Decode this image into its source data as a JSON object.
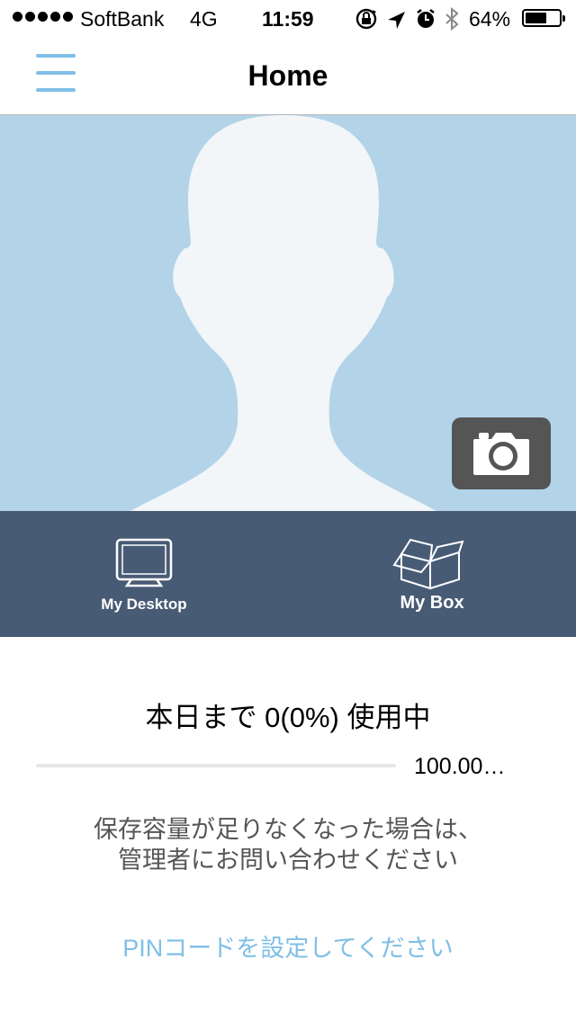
{
  "status_bar": {
    "signal_bars": 5,
    "carrier": "SoftBank",
    "network": "4G",
    "time": "11:59",
    "icons": [
      "rotation-lock-icon",
      "location-icon",
      "alarm-icon",
      "bluetooth-icon"
    ],
    "battery_percent": "64%",
    "battery_level": 0.64
  },
  "nav": {
    "title": "Home",
    "menu_icon": "hamburger-menu-icon"
  },
  "profile": {
    "avatar_icon": "person-silhouette-icon",
    "camera_icon": "camera-icon"
  },
  "tabs": [
    {
      "label": "My Desktop",
      "icon": "monitor-icon"
    },
    {
      "label": "My Box",
      "icon": "box-icon"
    }
  ],
  "usage": {
    "text": "本日まで 0(0%) 使用中",
    "percent": 0,
    "capacity": "100.00…"
  },
  "notice": {
    "line1": "保存容量が足りなくなった場合は、",
    "line2": "管理者にお問い合わせください"
  },
  "pin_link": "PINコードを設定してください",
  "colors": {
    "accent": "#7fbfe6",
    "tab_bar": "#485b75",
    "profile_bg": "#b3d4e8",
    "camera_button": "#555555"
  }
}
